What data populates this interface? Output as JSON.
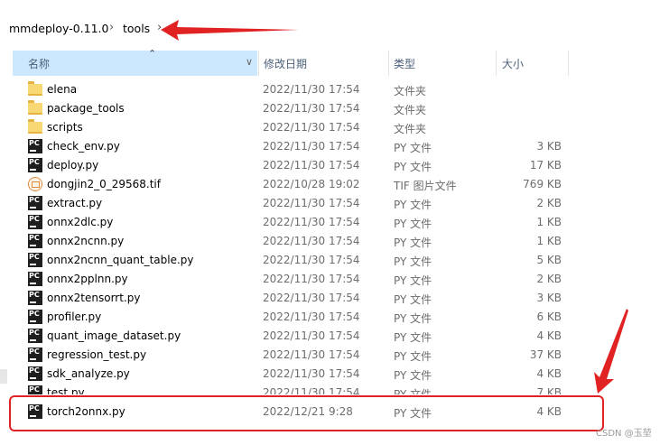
{
  "breadcrumb": {
    "root": "mmdeploy-0.11.0",
    "current": "tools",
    "chevron": "›"
  },
  "columns": {
    "name": "名称",
    "date": "修改日期",
    "type": "类型",
    "size": "大小"
  },
  "files": [
    {
      "name": "elena",
      "date": "2022/11/30 17:54",
      "type": "文件夹",
      "size": "",
      "icon": "folder"
    },
    {
      "name": "package_tools",
      "date": "2022/11/30 17:54",
      "type": "文件夹",
      "size": "",
      "icon": "folder"
    },
    {
      "name": "scripts",
      "date": "2022/11/30 17:54",
      "type": "文件夹",
      "size": "",
      "icon": "folder"
    },
    {
      "name": "check_env.py",
      "date": "2022/11/30 17:54",
      "type": "PY 文件",
      "size": "3 KB",
      "icon": "py"
    },
    {
      "name": "deploy.py",
      "date": "2022/11/30 17:54",
      "type": "PY 文件",
      "size": "17 KB",
      "icon": "py"
    },
    {
      "name": "dongjin2_0_29568.tif",
      "date": "2022/10/28 19:02",
      "type": "TIF 图片文件",
      "size": "769 KB",
      "icon": "tif"
    },
    {
      "name": "extract.py",
      "date": "2022/11/30 17:54",
      "type": "PY 文件",
      "size": "2 KB",
      "icon": "py"
    },
    {
      "name": "onnx2dlc.py",
      "date": "2022/11/30 17:54",
      "type": "PY 文件",
      "size": "1 KB",
      "icon": "py"
    },
    {
      "name": "onnx2ncnn.py",
      "date": "2022/11/30 17:54",
      "type": "PY 文件",
      "size": "1 KB",
      "icon": "py"
    },
    {
      "name": "onnx2ncnn_quant_table.py",
      "date": "2022/11/30 17:54",
      "type": "PY 文件",
      "size": "5 KB",
      "icon": "py"
    },
    {
      "name": "onnx2pplnn.py",
      "date": "2022/11/30 17:54",
      "type": "PY 文件",
      "size": "2 KB",
      "icon": "py"
    },
    {
      "name": "onnx2tensorrt.py",
      "date": "2022/11/30 17:54",
      "type": "PY 文件",
      "size": "3 KB",
      "icon": "py"
    },
    {
      "name": "profiler.py",
      "date": "2022/11/30 17:54",
      "type": "PY 文件",
      "size": "6 KB",
      "icon": "py"
    },
    {
      "name": "quant_image_dataset.py",
      "date": "2022/11/30 17:54",
      "type": "PY 文件",
      "size": "4 KB",
      "icon": "py"
    },
    {
      "name": "regression_test.py",
      "date": "2022/11/30 17:54",
      "type": "PY 文件",
      "size": "37 KB",
      "icon": "py"
    },
    {
      "name": "sdk_analyze.py",
      "date": "2022/11/30 17:54",
      "type": "PY 文件",
      "size": "4 KB",
      "icon": "py"
    },
    {
      "name": "test.py",
      "date": "2022/11/30 17:54",
      "type": "PY 文件",
      "size": "7 KB",
      "icon": "py"
    },
    {
      "name": "torch2onnx.py",
      "date": "2022/12/21 9:28",
      "type": "PY 文件",
      "size": "4 KB",
      "icon": "py"
    }
  ],
  "watermark": "CSDN @玉堃",
  "colors": {
    "header_selected": "#cce8ff",
    "annotation": "#e02222"
  }
}
